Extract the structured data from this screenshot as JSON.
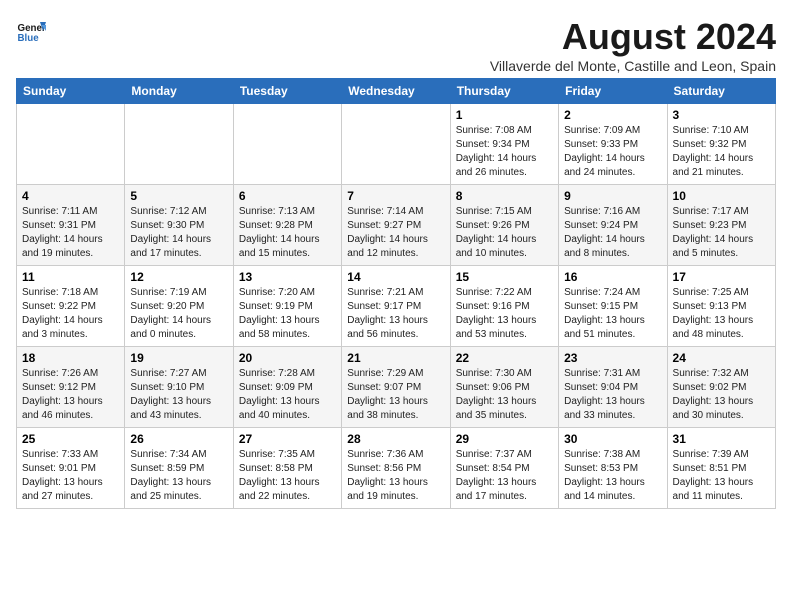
{
  "logo": {
    "text_general": "General",
    "text_blue": "Blue"
  },
  "header": {
    "month_year": "August 2024",
    "location": "Villaverde del Monte, Castille and Leon, Spain"
  },
  "weekdays": [
    "Sunday",
    "Monday",
    "Tuesday",
    "Wednesday",
    "Thursday",
    "Friday",
    "Saturday"
  ],
  "weeks": [
    [
      {
        "day": "",
        "info": ""
      },
      {
        "day": "",
        "info": ""
      },
      {
        "day": "",
        "info": ""
      },
      {
        "day": "",
        "info": ""
      },
      {
        "day": "1",
        "info": "Sunrise: 7:08 AM\nSunset: 9:34 PM\nDaylight: 14 hours\nand 26 minutes."
      },
      {
        "day": "2",
        "info": "Sunrise: 7:09 AM\nSunset: 9:33 PM\nDaylight: 14 hours\nand 24 minutes."
      },
      {
        "day": "3",
        "info": "Sunrise: 7:10 AM\nSunset: 9:32 PM\nDaylight: 14 hours\nand 21 minutes."
      }
    ],
    [
      {
        "day": "4",
        "info": "Sunrise: 7:11 AM\nSunset: 9:31 PM\nDaylight: 14 hours\nand 19 minutes."
      },
      {
        "day": "5",
        "info": "Sunrise: 7:12 AM\nSunset: 9:30 PM\nDaylight: 14 hours\nand 17 minutes."
      },
      {
        "day": "6",
        "info": "Sunrise: 7:13 AM\nSunset: 9:28 PM\nDaylight: 14 hours\nand 15 minutes."
      },
      {
        "day": "7",
        "info": "Sunrise: 7:14 AM\nSunset: 9:27 PM\nDaylight: 14 hours\nand 12 minutes."
      },
      {
        "day": "8",
        "info": "Sunrise: 7:15 AM\nSunset: 9:26 PM\nDaylight: 14 hours\nand 10 minutes."
      },
      {
        "day": "9",
        "info": "Sunrise: 7:16 AM\nSunset: 9:24 PM\nDaylight: 14 hours\nand 8 minutes."
      },
      {
        "day": "10",
        "info": "Sunrise: 7:17 AM\nSunset: 9:23 PM\nDaylight: 14 hours\nand 5 minutes."
      }
    ],
    [
      {
        "day": "11",
        "info": "Sunrise: 7:18 AM\nSunset: 9:22 PM\nDaylight: 14 hours\nand 3 minutes."
      },
      {
        "day": "12",
        "info": "Sunrise: 7:19 AM\nSunset: 9:20 PM\nDaylight: 14 hours\nand 0 minutes."
      },
      {
        "day": "13",
        "info": "Sunrise: 7:20 AM\nSunset: 9:19 PM\nDaylight: 13 hours\nand 58 minutes."
      },
      {
        "day": "14",
        "info": "Sunrise: 7:21 AM\nSunset: 9:17 PM\nDaylight: 13 hours\nand 56 minutes."
      },
      {
        "day": "15",
        "info": "Sunrise: 7:22 AM\nSunset: 9:16 PM\nDaylight: 13 hours\nand 53 minutes."
      },
      {
        "day": "16",
        "info": "Sunrise: 7:24 AM\nSunset: 9:15 PM\nDaylight: 13 hours\nand 51 minutes."
      },
      {
        "day": "17",
        "info": "Sunrise: 7:25 AM\nSunset: 9:13 PM\nDaylight: 13 hours\nand 48 minutes."
      }
    ],
    [
      {
        "day": "18",
        "info": "Sunrise: 7:26 AM\nSunset: 9:12 PM\nDaylight: 13 hours\nand 46 minutes."
      },
      {
        "day": "19",
        "info": "Sunrise: 7:27 AM\nSunset: 9:10 PM\nDaylight: 13 hours\nand 43 minutes."
      },
      {
        "day": "20",
        "info": "Sunrise: 7:28 AM\nSunset: 9:09 PM\nDaylight: 13 hours\nand 40 minutes."
      },
      {
        "day": "21",
        "info": "Sunrise: 7:29 AM\nSunset: 9:07 PM\nDaylight: 13 hours\nand 38 minutes."
      },
      {
        "day": "22",
        "info": "Sunrise: 7:30 AM\nSunset: 9:06 PM\nDaylight: 13 hours\nand 35 minutes."
      },
      {
        "day": "23",
        "info": "Sunrise: 7:31 AM\nSunset: 9:04 PM\nDaylight: 13 hours\nand 33 minutes."
      },
      {
        "day": "24",
        "info": "Sunrise: 7:32 AM\nSunset: 9:02 PM\nDaylight: 13 hours\nand 30 minutes."
      }
    ],
    [
      {
        "day": "25",
        "info": "Sunrise: 7:33 AM\nSunset: 9:01 PM\nDaylight: 13 hours\nand 27 minutes."
      },
      {
        "day": "26",
        "info": "Sunrise: 7:34 AM\nSunset: 8:59 PM\nDaylight: 13 hours\nand 25 minutes."
      },
      {
        "day": "27",
        "info": "Sunrise: 7:35 AM\nSunset: 8:58 PM\nDaylight: 13 hours\nand 22 minutes."
      },
      {
        "day": "28",
        "info": "Sunrise: 7:36 AM\nSunset: 8:56 PM\nDaylight: 13 hours\nand 19 minutes."
      },
      {
        "day": "29",
        "info": "Sunrise: 7:37 AM\nSunset: 8:54 PM\nDaylight: 13 hours\nand 17 minutes."
      },
      {
        "day": "30",
        "info": "Sunrise: 7:38 AM\nSunset: 8:53 PM\nDaylight: 13 hours\nand 14 minutes."
      },
      {
        "day": "31",
        "info": "Sunrise: 7:39 AM\nSunset: 8:51 PM\nDaylight: 13 hours\nand 11 minutes."
      }
    ]
  ]
}
